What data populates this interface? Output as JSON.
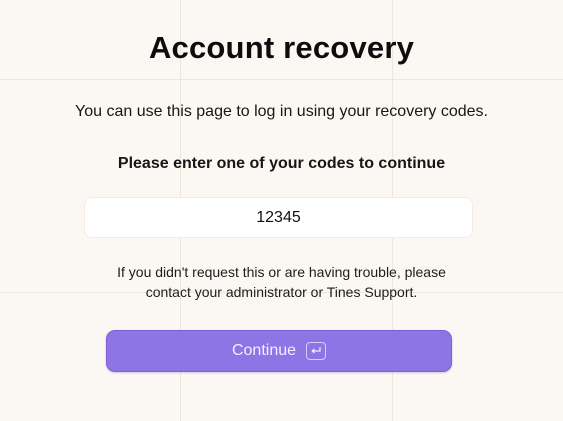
{
  "page": {
    "title": "Account recovery",
    "description": "You can use this page to log in using your recovery codes.",
    "prompt": "Please enter one of your codes to continue"
  },
  "code_input": {
    "value": "12345",
    "placeholder": ""
  },
  "help": {
    "line1": "If you didn't request this or are having trouble, please",
    "line2": "contact your administrator or Tines Support."
  },
  "continue_button": {
    "label": "Continue",
    "shortcut_icon": "enter-key-icon"
  },
  "colors": {
    "background": "#fbf8f4",
    "accent": "#8f74e6"
  }
}
